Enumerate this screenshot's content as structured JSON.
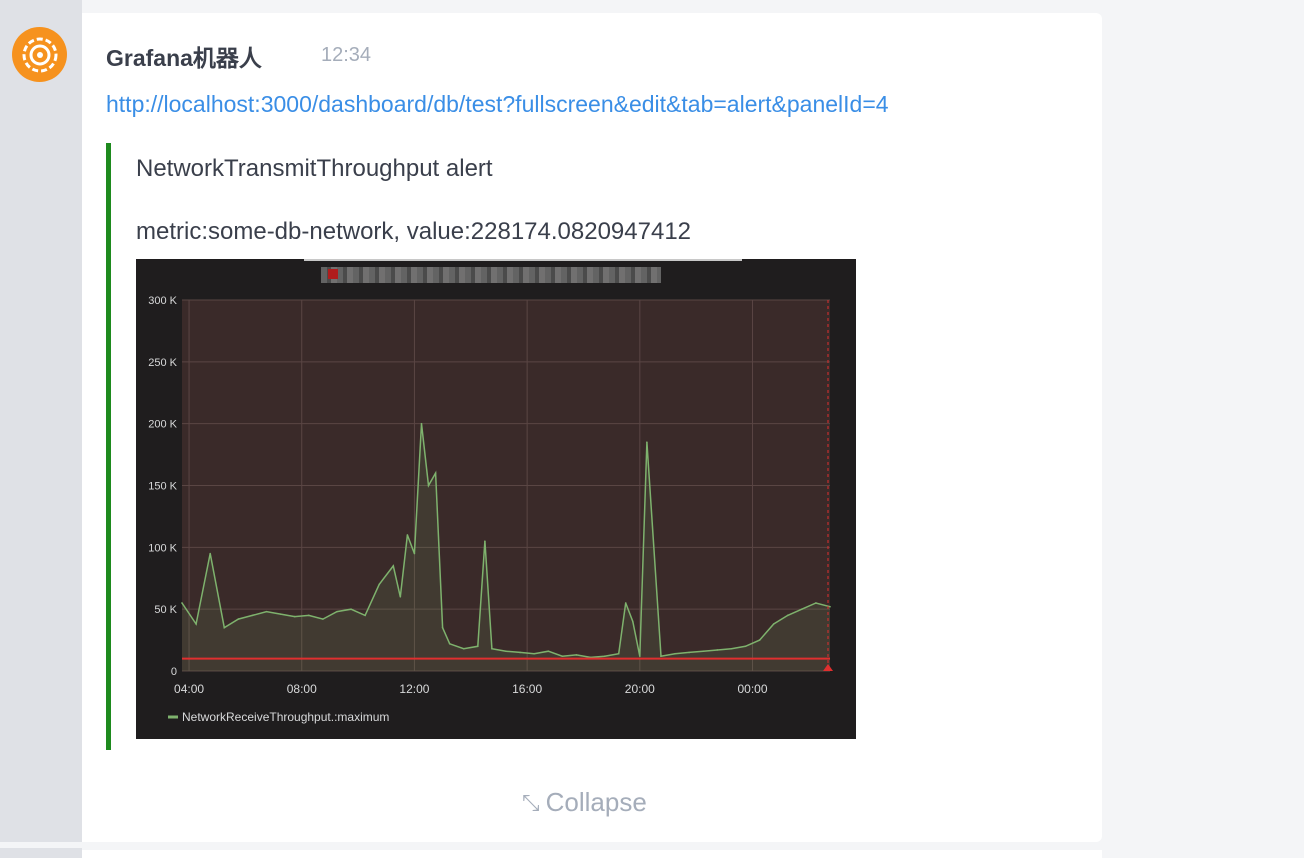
{
  "message": {
    "sender": "Grafana机器人",
    "time": "12:34",
    "link": "http://localhost:3000/dashboard/db/test?fullscreen&edit&tab=alert&panelId=4",
    "alert_title": "NetworkTransmitThroughput alert",
    "alert_metric": "metric:some-db-network, value:228174.0820947412",
    "collapse_label": "Collapse"
  },
  "colors": {
    "link": "#3a8ee6",
    "quote_bar": "#1e8a1e",
    "avatar": "#f6921e",
    "series": "#7eb26d",
    "threshold": "#e02f2f"
  },
  "icons": {
    "avatar": "grafana-logo-icon",
    "collapse": "collapse-arrows-icon"
  },
  "chart_data": {
    "type": "area",
    "title": "",
    "xlabel": "",
    "ylabel": "",
    "x_ticks": [
      "04:00",
      "08:00",
      "12:00",
      "16:00",
      "20:00",
      "00:00"
    ],
    "y_ticks": [
      "0",
      "50 K",
      "100 K",
      "150 K",
      "200 K",
      "250 K",
      "300 K"
    ],
    "ylim": [
      0,
      300000
    ],
    "grid": true,
    "legend": "bottom-left",
    "threshold": 10000,
    "series": [
      {
        "name": "NetworkReceiveThroughput.:maximum",
        "x": [
          "03:45",
          "04:15",
          "04:45",
          "05:15",
          "05:45",
          "06:15",
          "06:45",
          "07:15",
          "07:45",
          "08:15",
          "08:45",
          "09:15",
          "09:45",
          "10:15",
          "10:45",
          "11:15",
          "11:30",
          "11:45",
          "12:00",
          "12:15",
          "12:30",
          "12:45",
          "13:00",
          "13:15",
          "13:45",
          "14:15",
          "14:30",
          "14:45",
          "15:15",
          "15:45",
          "16:15",
          "16:45",
          "17:15",
          "17:45",
          "18:15",
          "18:45",
          "19:15",
          "19:30",
          "19:45",
          "20:00",
          "20:15",
          "20:45",
          "21:15",
          "21:45",
          "22:15",
          "22:45",
          "23:15",
          "23:45",
          "00:15",
          "00:45",
          "01:15",
          "01:45",
          "02:15",
          "02:45"
        ],
        "values": [
          55000,
          38000,
          95000,
          35000,
          42000,
          45000,
          48000,
          46000,
          44000,
          45000,
          42000,
          48000,
          50000,
          45000,
          70000,
          85000,
          60000,
          110000,
          95000,
          200000,
          150000,
          160000,
          35000,
          22000,
          18000,
          20000,
          105000,
          18000,
          16000,
          15000,
          14000,
          16000,
          12000,
          13000,
          11000,
          12000,
          14000,
          55000,
          40000,
          12000,
          185000,
          12000,
          14000,
          15000,
          16000,
          17000,
          18000,
          20000,
          25000,
          38000,
          45000,
          50000,
          55000,
          52000
        ]
      }
    ]
  }
}
